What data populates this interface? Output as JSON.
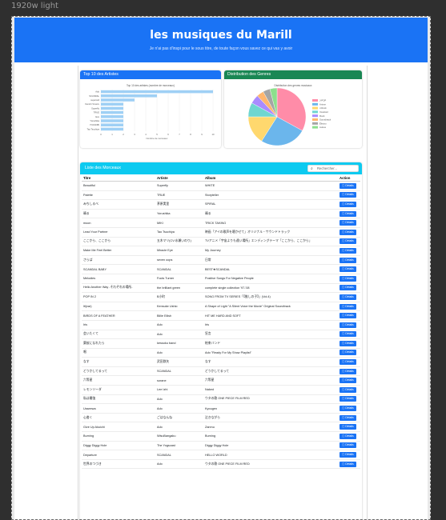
{
  "viewport_label": "1920w light",
  "header": {
    "title": "les musiques du Marill",
    "subtitle": "Je n'ai pas d'inspi pour le sous titre, de toute façon vous savez ce qui vas y avoir"
  },
  "top_artists": {
    "heading": "Top 10 des Artistes",
    "chart_title": "Top 10 des artistes (nombre de morceaux)",
    "xlabel": "Nombre de morceaux",
    "ticks": [
      "0",
      "1",
      "2",
      "3",
      "4",
      "5",
      "6",
      "7",
      "8",
      "9",
      "10"
    ]
  },
  "genres": {
    "heading": "Distribution des Genres",
    "chart_title": "Distribution des genres musicaux"
  },
  "chart_data": [
    {
      "type": "bar",
      "orientation": "horizontal",
      "title": "Top 10 des artistes (nombre de morceaux)",
      "xlabel": "Nombre de morceaux",
      "ylabel": "",
      "xlim": [
        0,
        10
      ],
      "categories": [
        "Ado",
        "SCANDAL",
        "supercell",
        "Kenshi Yonezu",
        "Superfly",
        "TRUE",
        "Eve",
        "Yorushika",
        "YOASOBI",
        "Tao Tsuchiya"
      ],
      "values": [
        10,
        5,
        3,
        2,
        2,
        2,
        2,
        2,
        2,
        2
      ],
      "color": "#9fd0f5"
    },
    {
      "type": "pie",
      "title": "Distribution des genres musicaux",
      "categories": [
        "J-POP",
        "Anime",
        "J-Rock",
        "Vocaloid",
        "Rock",
        "Soundtrack",
        "Électro",
        "Autres"
      ],
      "values": [
        33,
        26,
        16,
        8,
        5,
        4,
        4,
        4
      ],
      "colors": [
        "#ff8ca8",
        "#6bb6ec",
        "#ffd86e",
        "#6fd6d0",
        "#a98bff",
        "#ffb66e",
        "#a5a5a5",
        "#8de08d"
      ]
    }
  ],
  "list": {
    "heading": "Liste des Morceaux",
    "search_placeholder": "Rechercher...",
    "columns": [
      "Titre",
      "Artiste",
      "Album",
      "Action"
    ],
    "button_label": "Détails",
    "rows": [
      [
        "Beautiful",
        "Superfly",
        "WHITE"
      ],
      [
        "Palette",
        "TRUE",
        "Storyteller"
      ],
      [
        "みちしるべ",
        "茅原実里",
        "SPIRAL"
      ],
      [
        "晴る",
        "Yorushika",
        "晴る"
      ],
      [
        "moon",
        "MIKI",
        "TRICK TAKING"
      ],
      [
        "Lead Your Partner",
        "Tao Tsuchiya",
        "映画「アイの歌声を聴かせて」オリジナル・サウンドトラック"
      ],
      [
        "ここから、ここから",
        "五木マリ(CV:水瀬いのり)",
        "TVアニメ「宇宙よりも遠い場所」エンディングテーマ「ここから、ここから」"
      ],
      [
        "Make Me Feel Better",
        "Miracle Eye",
        "My Journey"
      ],
      [
        "さらば",
        "seven oops",
        "日常"
      ],
      [
        "SCANDAL BABY",
        "SCANDAL",
        "BEST★SCANDAL"
      ],
      [
        "Melodies",
        "Fools Turner",
        "Positive Songs For Negative People"
      ],
      [
        "Hello Another Way -それぞれの場所-",
        "the brilliant green",
        "complete single collection '97-'08"
      ],
      [
        "POP IN 2",
        "B小町",
        "SONG FROM TV SERIES「【推しの子】」(Vol.4)"
      ],
      [
        "lit(var)",
        "Kensuke Ushio",
        "A Shape of Light \"A Silent Voice the Movie\" Original Soundtrack"
      ],
      [
        "BIRDS OF A FEATHER",
        "Billie Eilish",
        "HIT ME HARD AND SOFT"
      ],
      [
        "Iris",
        "Ado",
        "Iris"
      ],
      [
        "会いたくて",
        "Ado",
        "狂言"
      ],
      [
        "葉桜になれたら",
        "kessoku band",
        "結束バンド"
      ],
      [
        "唱",
        "Ado",
        "Ado \"Ready For My Show Playlist\""
      ],
      [
        "なす",
        "武田鉄矢",
        "なす"
      ],
      [
        "どうかしてるって",
        "SCANDAL",
        "どうかしてるって"
      ],
      [
        "六等星",
        "sorane",
        "六等星"
      ],
      [
        "レモンソーダ",
        "Lee Izhi",
        "Naked"
      ],
      [
        "私は最強",
        "Ado",
        "ウタの歌 ONE PIECE FILM RED"
      ],
      [
        "Usseewa",
        "Ado",
        "Kyougen"
      ],
      [
        "心書く",
        "ごはなんね",
        "泣きながら"
      ],
      [
        "Give Up Akuichi",
        "Ado",
        "Zanmu"
      ],
      [
        "Burning",
        "WisuBangaku",
        "Burning"
      ],
      [
        "Diggy Diggy Hole",
        "The Yogscast",
        "Diggy Diggy Hole"
      ],
      [
        "Departure",
        "SCANDAL",
        "HELLO WORLD"
      ],
      [
        "世界のつづき",
        "Ado",
        "ウタの歌 ONE PIECE FILM RED"
      ]
    ]
  }
}
